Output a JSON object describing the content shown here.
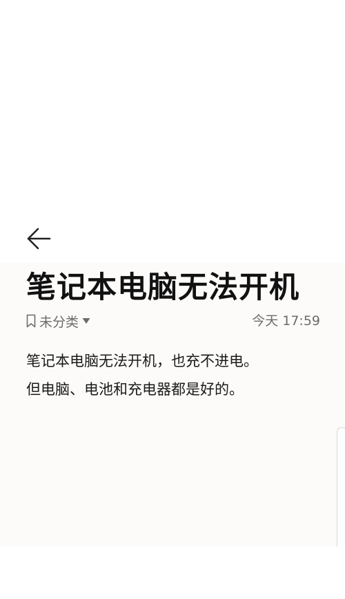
{
  "note": {
    "title": "笔记本电脑无法开机",
    "category": "未分类",
    "timestamp": "今天 17:59",
    "body_lines": [
      "笔记本电脑无法开机，也充不进电。",
      "但电脑、电池和充电器都是好的。"
    ]
  },
  "icons": {
    "back": "arrow-left-icon",
    "category": "bookmark-icon",
    "dropdown": "caret-down-icon"
  }
}
